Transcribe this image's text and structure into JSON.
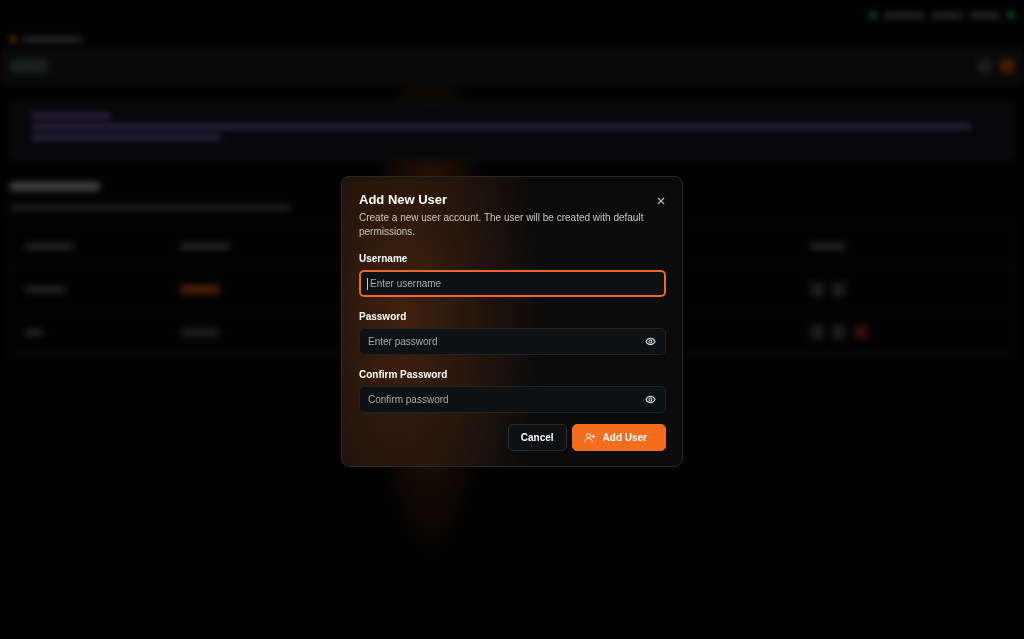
{
  "dialog": {
    "title": "Add New User",
    "description": "Create a new user account. The user will be created with default permissions.",
    "fields": [
      {
        "label": "Username",
        "placeholder": "Enter username",
        "kind": "text",
        "focused": true
      },
      {
        "label": "Password",
        "placeholder": "Enter password",
        "kind": "password",
        "focused": false
      },
      {
        "label": "Confirm Password",
        "placeholder": "Confirm password",
        "kind": "password",
        "focused": false
      }
    ],
    "buttons": [
      {
        "label": "Cancel",
        "kind": "secondary"
      },
      {
        "label": "Add User",
        "kind": "primary"
      }
    ]
  }
}
